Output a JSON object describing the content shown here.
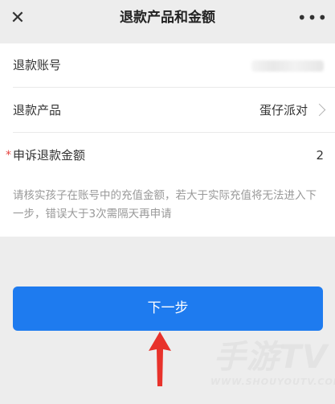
{
  "nav": {
    "title": "退款产品和金额",
    "close_glyph": "✕",
    "more_glyph": "•••"
  },
  "form": {
    "account": {
      "label": "退款账号"
    },
    "product": {
      "label": "退款产品",
      "value": "蛋仔派对"
    },
    "amount": {
      "label": "申诉退款金额",
      "value": "2",
      "required_mark": "*"
    }
  },
  "hint": "请核实孩子在账号中的充值金额，若大于实际充值将无法进入下一步，错误大于3次需隔天再申请",
  "next_button": {
    "label": "下一步"
  },
  "watermark": {
    "main": "手游TV",
    "sub": "WWW.SHOUYOUTV.COM"
  },
  "colors": {
    "primary": "#1e7bef",
    "arrow": "#e8322b",
    "required": "#e64340"
  },
  "icons": {
    "close": "close-icon",
    "more": "more-icon",
    "chevron": "chevron-right-icon",
    "arrow": "red-arrow-up-icon"
  }
}
